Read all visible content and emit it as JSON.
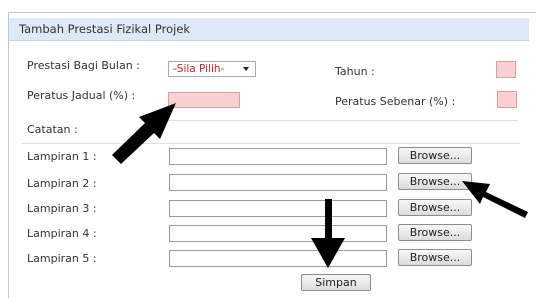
{
  "form": {
    "title": "Tambah Prestasi Fizikal Projek",
    "month_label": "Prestasi Bagi Bulan :",
    "month_select_value": "-Sila Pilih-",
    "year_label": "Tahun :",
    "planned_label": "Peratus Jadual (%) :",
    "actual_label": "Peratus Sebenar (%) :",
    "notes_label": "Catatan :",
    "attachments": [
      {
        "label": "Lampiran 1 :",
        "button": "Browse..."
      },
      {
        "label": "Lampiran 2 :",
        "button": "Browse..."
      },
      {
        "label": "Lampiran 3 :",
        "button": "Browse..."
      },
      {
        "label": "Lampiran 4 :",
        "button": "Browse..."
      },
      {
        "label": "Lampiran 5 :",
        "button": "Browse..."
      }
    ],
    "save_button": "Simpan"
  },
  "colors": {
    "header_bg": "#dfe8f6",
    "required_field_bg": "#fbd0d4",
    "select_text": "#d0202a",
    "annotation_arrow": "#000000"
  },
  "annotations": {
    "icons": [
      "arrow-to-planned-percent",
      "arrow-to-browse-2",
      "arrow-to-save-button"
    ]
  }
}
